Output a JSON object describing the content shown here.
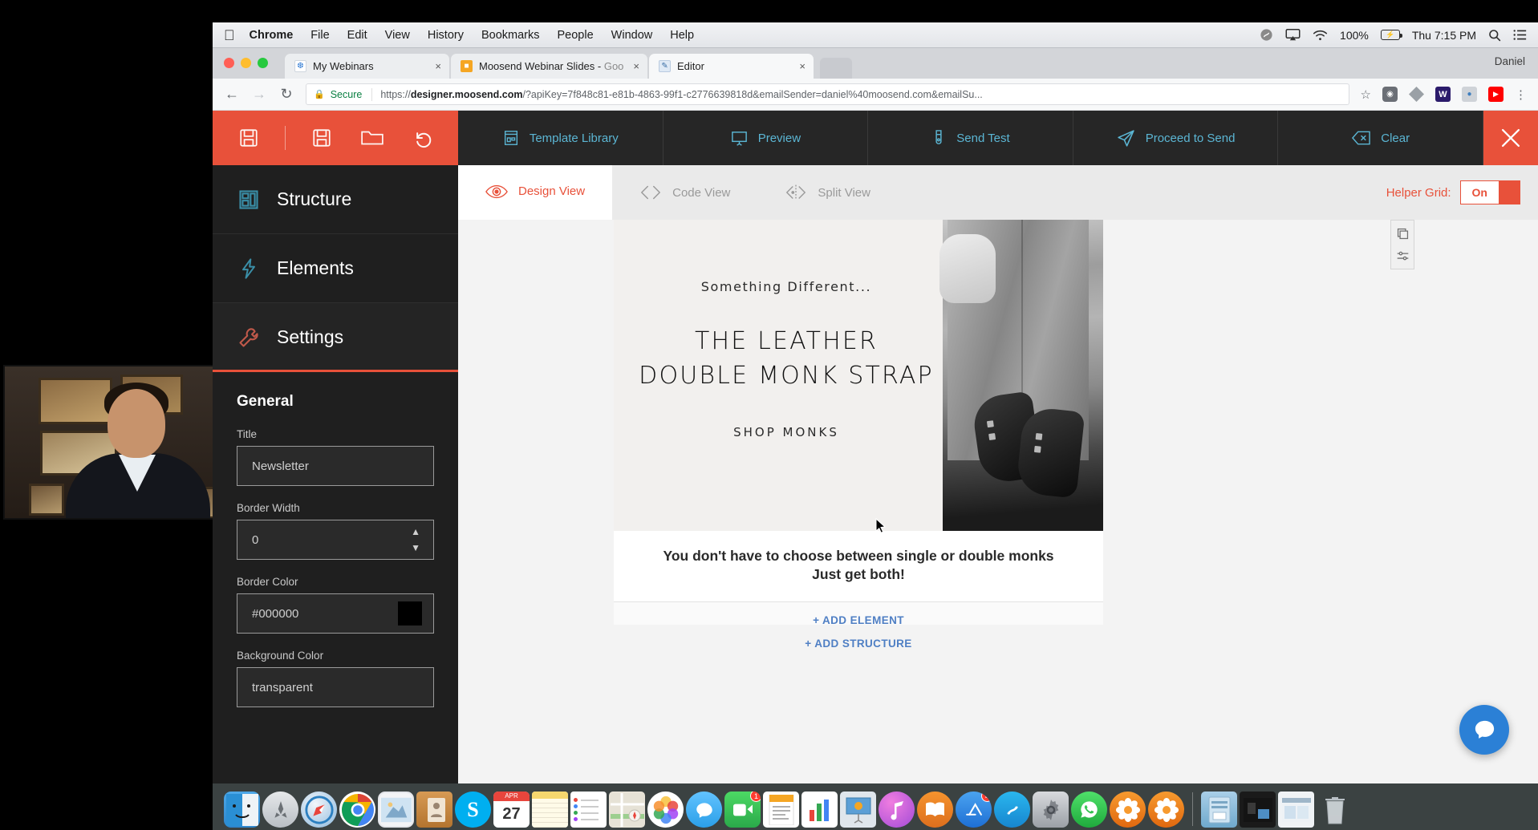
{
  "menubar": {
    "apple_icon": "apple-logo",
    "items": [
      "Chrome",
      "File",
      "Edit",
      "View",
      "History",
      "Bookmarks",
      "People",
      "Window",
      "Help"
    ],
    "status": {
      "shazam_icon": "shazam-icon",
      "airplay_icon": "airplay-icon",
      "wifi_icon": "wifi-icon",
      "battery_percent": "100%",
      "battery_icon": "battery-charging-icon",
      "clock": "Thu 7:15 PM",
      "search_icon": "spotlight-search-icon",
      "notification_icon": "notification-center-icon"
    }
  },
  "browser": {
    "user": "Daniel",
    "tabs": [
      {
        "title": "My Webinars",
        "favicon": "webinar-icon",
        "active": false
      },
      {
        "title": "Moosend Webinar Slides - ",
        "title_dim": "Goo",
        "favicon": "slides-icon",
        "active": false
      },
      {
        "title": "Editor",
        "favicon": "editor-icon",
        "active": true
      }
    ],
    "tab_close_label": "×",
    "omnibox": {
      "back_icon": "back-arrow-icon",
      "forward_icon": "forward-arrow-icon",
      "reload_icon": "reload-icon",
      "lock_icon": "lock-icon",
      "secure_label": "Secure",
      "url_prefix": "https://",
      "url_domain": "designer.moosend.com",
      "url_rest": "/?apiKey=7f848c81-e81b-4863-99f1-c2776639818d&emailSender=daniel%40moosend.com&emailSu...",
      "star_icon": "bookmark-star-icon",
      "extensions": [
        "camera-extension-icon",
        "compass-extension-icon",
        "wistia-extension-icon",
        "droplr-extension-icon",
        "youtube-extension-icon"
      ],
      "menu_icon": "chrome-menu-icon"
    }
  },
  "app_toolbar": {
    "left_icons": [
      "save-icon",
      "save-as-icon",
      "open-folder-icon",
      "undo-icon"
    ],
    "buttons": [
      {
        "label": "Template Library",
        "icon": "template-library-icon"
      },
      {
        "label": "Preview",
        "icon": "preview-screen-icon"
      },
      {
        "label": "Send Test",
        "icon": "test-tube-icon"
      },
      {
        "label": "Proceed to Send",
        "icon": "paper-plane-icon"
      },
      {
        "label": "Clear",
        "icon": "clear-backspace-icon"
      }
    ],
    "close_icon": "close-editor-icon"
  },
  "sidebar": {
    "items": [
      {
        "label": "Structure",
        "icon": "structure-layout-icon",
        "active": false
      },
      {
        "label": "Elements",
        "icon": "elements-bolt-icon",
        "active": false
      },
      {
        "label": "Settings",
        "icon": "settings-wrench-icon",
        "active": true
      }
    ],
    "settings": {
      "section_title": "General",
      "fields": [
        {
          "label": "Title",
          "value": "Newsletter",
          "type": "text"
        },
        {
          "label": "Border Width",
          "value": "0",
          "type": "number"
        },
        {
          "label": "Border Color",
          "value": "#000000",
          "type": "color",
          "swatch": "#000000"
        },
        {
          "label": "Background Color",
          "value": "transparent",
          "type": "color"
        }
      ]
    }
  },
  "view_bar": {
    "tabs": [
      {
        "label": "Design View",
        "icon": "eye-icon",
        "active": true
      },
      {
        "label": "Code View",
        "icon": "code-brackets-icon",
        "active": false
      },
      {
        "label": "Split View",
        "icon": "split-view-icon",
        "active": false
      }
    ],
    "helper_grid_label": "Helper Grid:",
    "helper_grid_state": "On",
    "accent_color": "#e8513a"
  },
  "email": {
    "hero": {
      "kicker": "Something Different...",
      "headline_line1": "THE LEATHER",
      "headline_line2": "DOUBLE MONK STRAP",
      "cta": "SHOP MONKS",
      "image_alt": "man-holding-monk-strap-shoes"
    },
    "caption_line1": "You don't have to choose between single or double monks",
    "caption_line2": "Just get both!",
    "add_element_label": "+ ADD ELEMENT",
    "add_structure_label": "+ ADD STRUCTURE",
    "float_tools": [
      "duplicate-icon",
      "settings-sliders-icon"
    ],
    "link_color": "#4f7fc4"
  },
  "chat": {
    "icon": "intercom-chat-icon",
    "color": "#2b80d6"
  },
  "dock": {
    "items": [
      {
        "name": "finder",
        "badge": null,
        "running": true
      },
      {
        "name": "launchpad",
        "badge": null,
        "running": false
      },
      {
        "name": "safari",
        "badge": null,
        "running": false
      },
      {
        "name": "chrome",
        "badge": null,
        "running": true
      },
      {
        "name": "mail",
        "badge": null,
        "running": false
      },
      {
        "name": "contacts",
        "badge": null,
        "running": false
      },
      {
        "name": "skype",
        "badge": null,
        "running": false
      },
      {
        "name": "calendar",
        "badge": null,
        "running": false,
        "label_month": "APR",
        "label_day": "27"
      },
      {
        "name": "notes",
        "badge": null,
        "running": false
      },
      {
        "name": "reminders",
        "badge": null,
        "running": false
      },
      {
        "name": "maps",
        "badge": null,
        "running": false
      },
      {
        "name": "photos",
        "badge": null,
        "running": false
      },
      {
        "name": "messages",
        "badge": null,
        "running": false
      },
      {
        "name": "facetime",
        "badge": "1",
        "running": false
      },
      {
        "name": "pages",
        "badge": null,
        "running": false
      },
      {
        "name": "numbers",
        "badge": null,
        "running": false
      },
      {
        "name": "keynote",
        "badge": null,
        "running": true
      },
      {
        "name": "itunes",
        "badge": null,
        "running": false
      },
      {
        "name": "ibooks",
        "badge": null,
        "running": false
      },
      {
        "name": "app-store",
        "badge": "4",
        "running": false
      },
      {
        "name": "shazam",
        "badge": null,
        "running": false
      },
      {
        "name": "system-preferences",
        "badge": null,
        "running": true
      },
      {
        "name": "whatsapp",
        "badge": null,
        "running": false
      },
      {
        "name": "photos-alt",
        "badge": null,
        "running": true
      },
      {
        "name": "photos-alt-2",
        "badge": null,
        "running": true
      },
      {
        "name": "downloads-folder",
        "badge": null,
        "running": false
      },
      {
        "name": "screenshot-file",
        "badge": null,
        "running": false
      },
      {
        "name": "document-file",
        "badge": null,
        "running": false
      },
      {
        "name": "trash",
        "badge": null,
        "running": false
      }
    ]
  }
}
